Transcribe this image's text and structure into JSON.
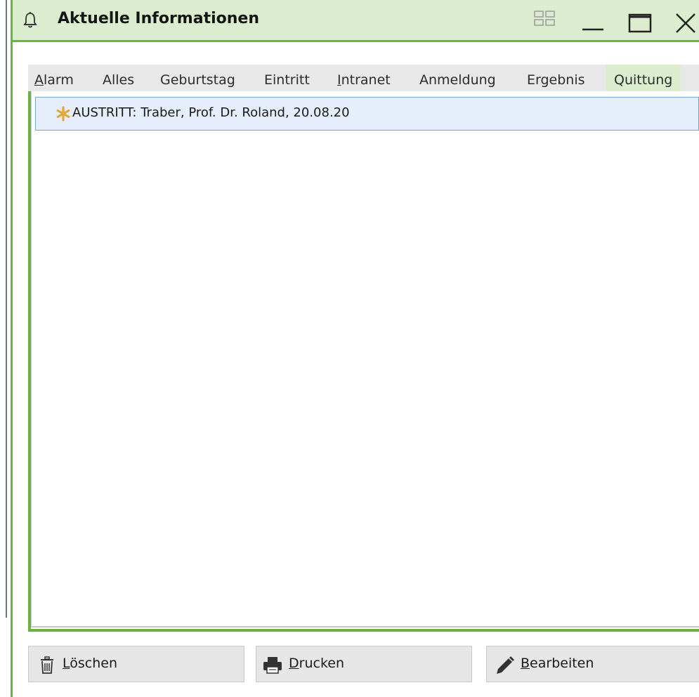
{
  "window": {
    "title": "Aktuelle Informationen"
  },
  "tabs": [
    {
      "mnemonic": "A",
      "rest": "larm"
    },
    {
      "mnemonic": "",
      "rest": "Alles"
    },
    {
      "mnemonic": "",
      "rest": "Geburtstag"
    },
    {
      "mnemonic": "",
      "rest": "Eintritt"
    },
    {
      "mnemonic": "I",
      "rest": "ntranet"
    },
    {
      "mnemonic": "",
      "rest": "Anmeldung"
    },
    {
      "mnemonic": "",
      "rest": "Ergebnis"
    },
    {
      "mnemonic": "",
      "rest": "Quittung"
    }
  ],
  "active_tab": "Quittung",
  "list": {
    "items": [
      {
        "text": "AUSTRITT: Traber, Prof. Dr. Roland, 20.08.20",
        "icon": "asterisk-icon"
      }
    ]
  },
  "buttons": {
    "delete": {
      "mnemonic": "L",
      "rest": "öschen"
    },
    "print": {
      "mnemonic": "D",
      "rest": "rucken"
    },
    "edit": {
      "mnemonic": "B",
      "rest": "earbeiten"
    }
  },
  "colors": {
    "accent_green": "#6fb03f",
    "titlebar_bg": "#dceccf",
    "selection_bg": "#e5eefa",
    "asterisk": "#e0a73a"
  }
}
